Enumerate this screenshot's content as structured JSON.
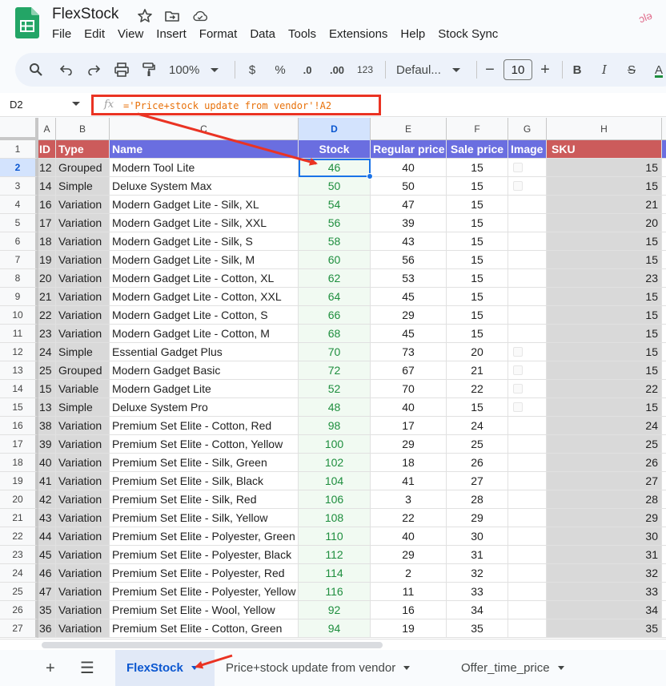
{
  "app": {
    "title": "FlexStock",
    "menu": [
      "File",
      "Edit",
      "View",
      "Insert",
      "Format",
      "Data",
      "Tools",
      "Extensions",
      "Help",
      "Stock Sync"
    ],
    "corner_badge": "ↄlə"
  },
  "toolbar": {
    "zoom": "100%",
    "currency": "$",
    "percent": "%",
    "dec_decrease": ".0",
    "dec_increase": ".00",
    "number_format": "123",
    "font": "Defaul...",
    "font_size": "10",
    "bold": "B",
    "italic": "I",
    "strike": "S",
    "text_color": "A"
  },
  "formula_bar": {
    "cell_ref": "D2",
    "fx": "fx",
    "formula": "='Price+stock update from vendor'!A2"
  },
  "columns": [
    "A",
    "B",
    "C",
    "D",
    "E",
    "F",
    "G",
    "H"
  ],
  "selected_column": "D",
  "header_row": {
    "id": "ID",
    "type": "Type",
    "name": "Name",
    "stock": "Stock",
    "regular_price": "Regular price",
    "sale_price": "Sale price",
    "image": "Image",
    "sku": "SKU"
  },
  "rows": [
    {
      "n": "2",
      "id": "12",
      "type": "Grouped",
      "name": "Modern Tool Lite",
      "stock": "46",
      "reg": "40",
      "sale": "15",
      "img": true,
      "sku": "15"
    },
    {
      "n": "3",
      "id": "14",
      "type": "Simple",
      "name": "Deluxe System Max",
      "stock": "50",
      "reg": "50",
      "sale": "15",
      "img": true,
      "sku": "15"
    },
    {
      "n": "4",
      "id": "16",
      "type": "Variation",
      "name": "Modern Gadget Lite - Silk, XL",
      "stock": "54",
      "reg": "47",
      "sale": "15",
      "img": false,
      "sku": "21"
    },
    {
      "n": "5",
      "id": "17",
      "type": "Variation",
      "name": "Modern Gadget Lite - Silk, XXL",
      "stock": "56",
      "reg": "39",
      "sale": "15",
      "img": false,
      "sku": "20"
    },
    {
      "n": "6",
      "id": "18",
      "type": "Variation",
      "name": "Modern Gadget Lite - Silk, S",
      "stock": "58",
      "reg": "43",
      "sale": "15",
      "img": false,
      "sku": "15"
    },
    {
      "n": "7",
      "id": "19",
      "type": "Variation",
      "name": "Modern Gadget Lite - Silk, M",
      "stock": "60",
      "reg": "56",
      "sale": "15",
      "img": false,
      "sku": "15"
    },
    {
      "n": "8",
      "id": "20",
      "type": "Variation",
      "name": "Modern Gadget Lite - Cotton, XL",
      "stock": "62",
      "reg": "53",
      "sale": "15",
      "img": false,
      "sku": "23"
    },
    {
      "n": "9",
      "id": "21",
      "type": "Variation",
      "name": "Modern Gadget Lite - Cotton, XXL",
      "stock": "64",
      "reg": "45",
      "sale": "15",
      "img": false,
      "sku": "15"
    },
    {
      "n": "10",
      "id": "22",
      "type": "Variation",
      "name": "Modern Gadget Lite - Cotton, S",
      "stock": "66",
      "reg": "29",
      "sale": "15",
      "img": false,
      "sku": "15"
    },
    {
      "n": "11",
      "id": "23",
      "type": "Variation",
      "name": "Modern Gadget Lite - Cotton, M",
      "stock": "68",
      "reg": "45",
      "sale": "15",
      "img": false,
      "sku": "15"
    },
    {
      "n": "12",
      "id": "24",
      "type": "Simple",
      "name": "Essential Gadget Plus",
      "stock": "70",
      "reg": "73",
      "sale": "20",
      "img": true,
      "sku": "15"
    },
    {
      "n": "13",
      "id": "25",
      "type": "Grouped",
      "name": "Modern Gadget Basic",
      "stock": "72",
      "reg": "67",
      "sale": "21",
      "img": true,
      "sku": "15"
    },
    {
      "n": "14",
      "id": "15",
      "type": "Variable",
      "name": "Modern Gadget Lite",
      "stock": "52",
      "reg": "70",
      "sale": "22",
      "img": true,
      "sku": "22"
    },
    {
      "n": "15",
      "id": "13",
      "type": "Simple",
      "name": "Deluxe System Pro",
      "stock": "48",
      "reg": "40",
      "sale": "15",
      "img": true,
      "sku": "15"
    },
    {
      "n": "16",
      "id": "38",
      "type": "Variation",
      "name": "Premium Set Elite - Cotton, Red",
      "stock": "98",
      "reg": "17",
      "sale": "24",
      "img": false,
      "sku": "24"
    },
    {
      "n": "17",
      "id": "39",
      "type": "Variation",
      "name": "Premium Set Elite - Cotton, Yellow",
      "stock": "100",
      "reg": "29",
      "sale": "25",
      "img": false,
      "sku": "25"
    },
    {
      "n": "18",
      "id": "40",
      "type": "Variation",
      "name": "Premium Set Elite - Silk, Green",
      "stock": "102",
      "reg": "18",
      "sale": "26",
      "img": false,
      "sku": "26"
    },
    {
      "n": "19",
      "id": "41",
      "type": "Variation",
      "name": "Premium Set Elite - Silk, Black",
      "stock": "104",
      "reg": "41",
      "sale": "27",
      "img": false,
      "sku": "27"
    },
    {
      "n": "20",
      "id": "42",
      "type": "Variation",
      "name": "Premium Set Elite - Silk, Red",
      "stock": "106",
      "reg": "3",
      "sale": "28",
      "img": false,
      "sku": "28"
    },
    {
      "n": "21",
      "id": "43",
      "type": "Variation",
      "name": "Premium Set Elite - Silk, Yellow",
      "stock": "108",
      "reg": "22",
      "sale": "29",
      "img": false,
      "sku": "29"
    },
    {
      "n": "22",
      "id": "44",
      "type": "Variation",
      "name": "Premium Set Elite - Polyester, Green",
      "stock": "110",
      "reg": "40",
      "sale": "30",
      "img": false,
      "sku": "30"
    },
    {
      "n": "23",
      "id": "45",
      "type": "Variation",
      "name": "Premium Set Elite - Polyester, Black",
      "stock": "112",
      "reg": "29",
      "sale": "31",
      "img": false,
      "sku": "31"
    },
    {
      "n": "24",
      "id": "46",
      "type": "Variation",
      "name": "Premium Set Elite - Polyester, Red",
      "stock": "114",
      "reg": "2",
      "sale": "32",
      "img": false,
      "sku": "32"
    },
    {
      "n": "25",
      "id": "47",
      "type": "Variation",
      "name": "Premium Set Elite - Polyester, Yellow",
      "stock": "116",
      "reg": "11",
      "sale": "33",
      "img": false,
      "sku": "33"
    },
    {
      "n": "26",
      "id": "35",
      "type": "Variation",
      "name": "Premium Set Elite - Wool, Yellow",
      "stock": "92",
      "reg": "16",
      "sale": "34",
      "img": false,
      "sku": "34"
    },
    {
      "n": "27",
      "id": "36",
      "type": "Variation",
      "name": "Premium Set Elite - Cotton, Green",
      "stock": "94",
      "reg": "19",
      "sale": "35",
      "img": false,
      "sku": "35"
    }
  ],
  "sheet_tabs": [
    "FlexStock",
    "Price+stock update from vendor",
    "Offer_time_price"
  ],
  "active_tab": "FlexStock",
  "colors": {
    "accent": "#0b57d0",
    "header_red": "#cc5b5b",
    "header_blue": "#6a6ee0",
    "stock_green": "#1e8e3e",
    "annotation_red": "#ea3323"
  }
}
